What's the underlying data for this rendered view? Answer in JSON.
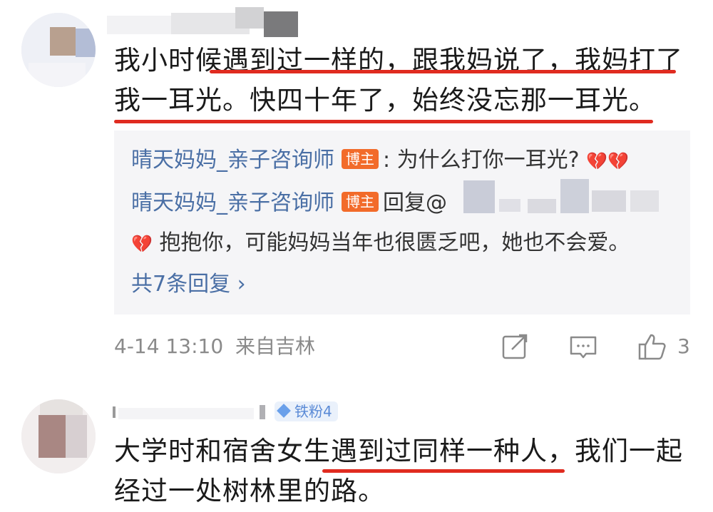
{
  "comment1": {
    "line1": "我小时候遇到过一样的，跟我妈说了，我妈打了",
    "line2": "我一耳光。快四十年了，始终没忘那一耳光。",
    "time": "4-14 13:10",
    "location": "来自吉林",
    "like_count": "3",
    "replies": [
      {
        "author": "晴天妈妈_亲子咨询师",
        "badge": "博主",
        "text": ": 为什么打你一耳光?",
        "emoji": "💔💔"
      },
      {
        "author": "晴天妈妈_亲子咨询师",
        "badge": "博主",
        "text": "回复@",
        "emoji": "💔",
        "text2": "抱抱你，可能妈妈当年也很匮乏吧，她也不会爱。"
      }
    ],
    "more_replies": "共7条回复 ›"
  },
  "comment2": {
    "fan_badge": "铁粉4",
    "line1": "大学时和宿舍女生遇到过同样一种人，我们一起",
    "line2": "经过一处树林里的路。"
  },
  "colors": {
    "underline": "#e02b20",
    "link": "#4a6fa5",
    "badge": "#f26b2a",
    "meta": "#8a8a8a",
    "reply_bg": "#f5f5f7"
  },
  "icons": [
    "share-icon",
    "comment-icon",
    "like-icon",
    "broken-heart-icon",
    "fan-gem-icon"
  ]
}
